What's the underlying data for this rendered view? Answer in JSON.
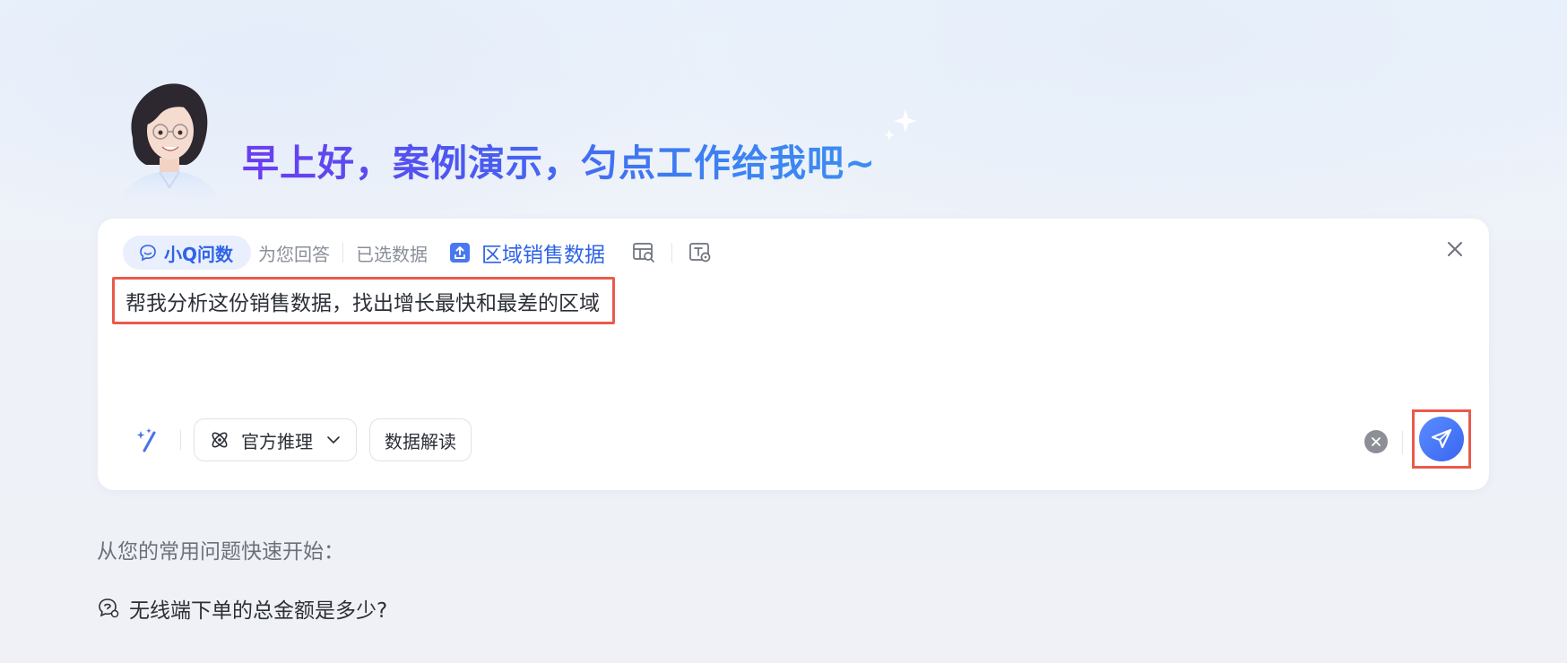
{
  "greeting": "早上好，案例演示，匀点工作给我吧~",
  "toolbar": {
    "assistant_label": "小Q问数",
    "assistant_suffix": "为您回答",
    "selected_label": "已选数据",
    "dataset_name": "区域销售数据"
  },
  "query": {
    "text": "帮我分析这份销售数据，找出增长最快和最差的区域"
  },
  "bottom": {
    "mode_label": "官方推理",
    "interpret_label": "数据解读"
  },
  "quick": {
    "title": "从您的常用问题快速开始：",
    "items": [
      {
        "label": "无线端下单的总金额是多少?"
      }
    ]
  },
  "icons": {
    "assistant": "chat-bubble-icon",
    "dataset": "upload-file-icon",
    "table_search": "table-search-icon",
    "text_setting": "text-setting-icon",
    "close": "close-icon",
    "magic": "magic-wand-icon",
    "mode": "atom-icon",
    "dropdown": "chevron-down-icon",
    "clear": "clear-icon",
    "send": "send-icon",
    "quick_question": "question-bubble-icon"
  },
  "colors": {
    "accent": "#2f63e7",
    "highlight_border": "#ea5a4b",
    "send_button": "#4a76f5"
  }
}
